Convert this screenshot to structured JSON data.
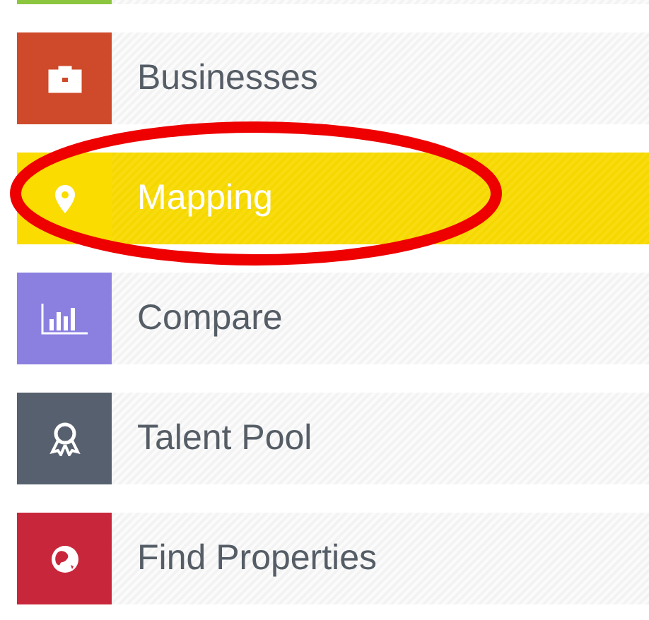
{
  "menu": [
    {
      "color": "#8cc63f",
      "selected": false
    },
    {
      "label": "Businesses",
      "color": "#cf4a2a",
      "selected": false
    },
    {
      "label": "Mapping",
      "color": "#fadc00",
      "selected": true
    },
    {
      "label": "Compare",
      "color": "#8b80e0",
      "selected": false
    },
    {
      "label": "Talent Pool",
      "color": "#57606e",
      "selected": false
    },
    {
      "label": "Find Properties",
      "color": "#c8273b",
      "selected": false
    }
  ],
  "annotation": {
    "kind": "ellipse",
    "color": "#ee0000"
  }
}
